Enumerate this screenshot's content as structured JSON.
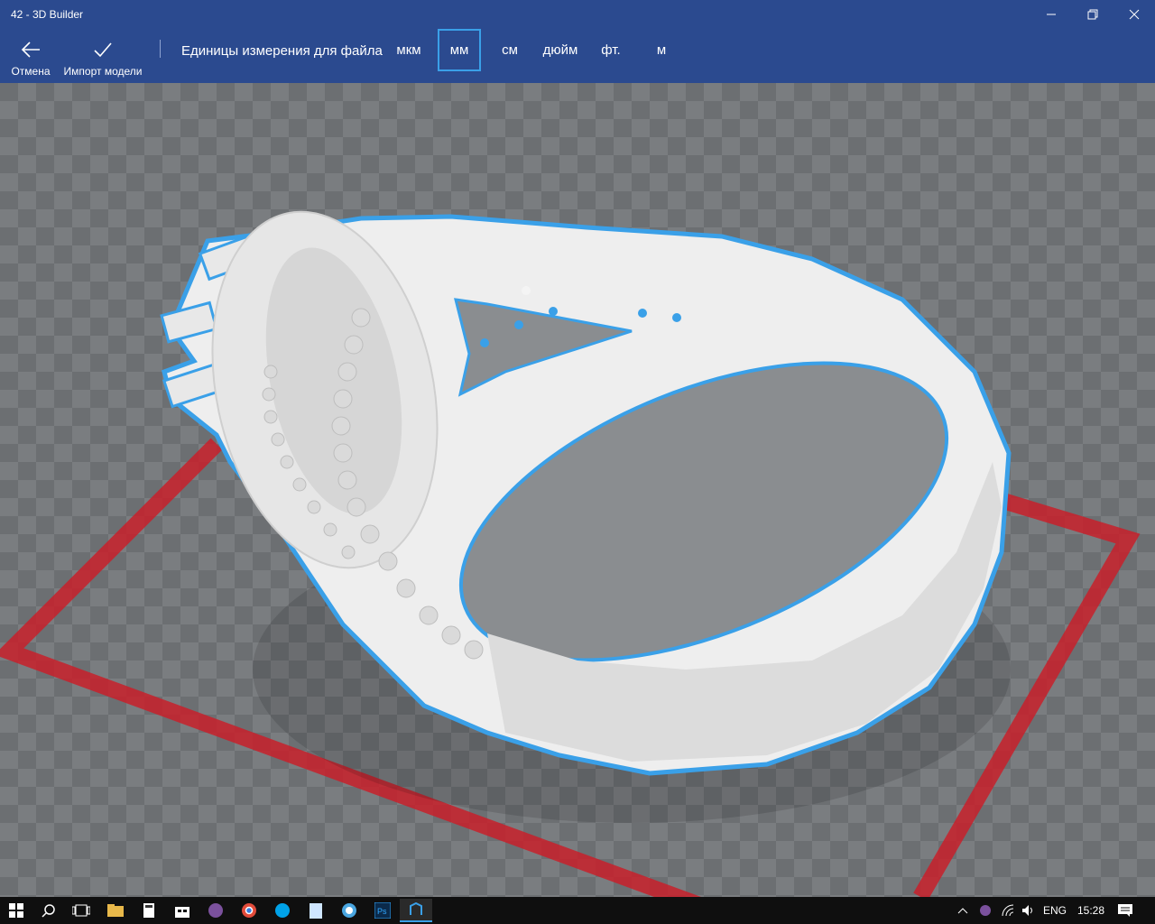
{
  "window": {
    "title": "42 - 3D Builder"
  },
  "toolbar": {
    "cancel_label": "Отмена",
    "import_label": "Импорт модели",
    "units_label": "Единицы измерения для файла",
    "units": [
      {
        "label": "мкм",
        "selected": false
      },
      {
        "label": "мм",
        "selected": true
      },
      {
        "label": "см",
        "selected": false
      },
      {
        "label": "дюйм",
        "selected": false
      },
      {
        "label": "фт.",
        "selected": false
      },
      {
        "label": "м",
        "selected": false
      }
    ]
  },
  "taskbar": {
    "apps": [
      "start-icon",
      "search-icon",
      "task-view-icon",
      "file-explorer-icon",
      "calculator-icon",
      "store-icon",
      "viber-icon",
      "chrome-icon",
      "skype-icon",
      "notepad-icon",
      "app-icon",
      "photoshop-icon",
      "3d-builder-icon"
    ],
    "photoshop_glyph": "Ps",
    "language": "ENG",
    "time": "15:28"
  },
  "colors": {
    "titlebar": "#2b4a8f",
    "accent": "#3aa0e8",
    "plate": "#c8202a",
    "model": "#eeeeee"
  }
}
